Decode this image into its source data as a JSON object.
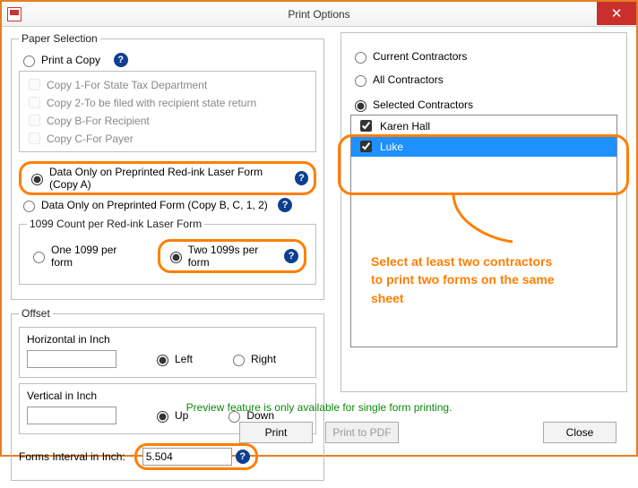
{
  "window": {
    "title": "Print Options"
  },
  "paper_selection": {
    "legend": "Paper Selection",
    "print_copy_label": "Print a Copy",
    "copies": [
      "Copy 1-For State Tax Department",
      "Copy 2-To be filed with recipient state return",
      "Copy B-For Recipient",
      "Copy C-For Payer"
    ],
    "data_only_redink_label": "Data Only on Preprinted Red-ink Laser Form (Copy A)",
    "data_only_preprinted_label": "Data Only on Preprinted  Form (Copy B, C, 1, 2)"
  },
  "count": {
    "legend": "1099 Count per Red-ink Laser Form",
    "one_label": "One 1099 per form",
    "two_label": "Two 1099s per form"
  },
  "offset": {
    "legend": "Offset",
    "horizontal_label": "Horizontal in Inch",
    "left_label": "Left",
    "right_label": "Right",
    "vertical_label": "Vertical in Inch",
    "up_label": "Up",
    "down_label": "Down",
    "forms_interval_label": "Forms Interval in Inch:",
    "forms_interval_value": "5.504"
  },
  "contractors": {
    "current_label": "Current Contractors",
    "all_label": "All Contractors",
    "selected_label": "Selected Contractors",
    "items": [
      {
        "name": "Karen Hall",
        "checked": true,
        "selected": false
      },
      {
        "name": "Luke",
        "checked": true,
        "selected": true
      }
    ]
  },
  "annotation": {
    "line1": "Select at least two contractors",
    "line2": "to print two forms on the same",
    "line3": "sheet"
  },
  "footer": {
    "message": "Preview feature is only available for single form printing.",
    "print": "Print",
    "print_pdf": "Print to PDF",
    "close": "Close"
  }
}
